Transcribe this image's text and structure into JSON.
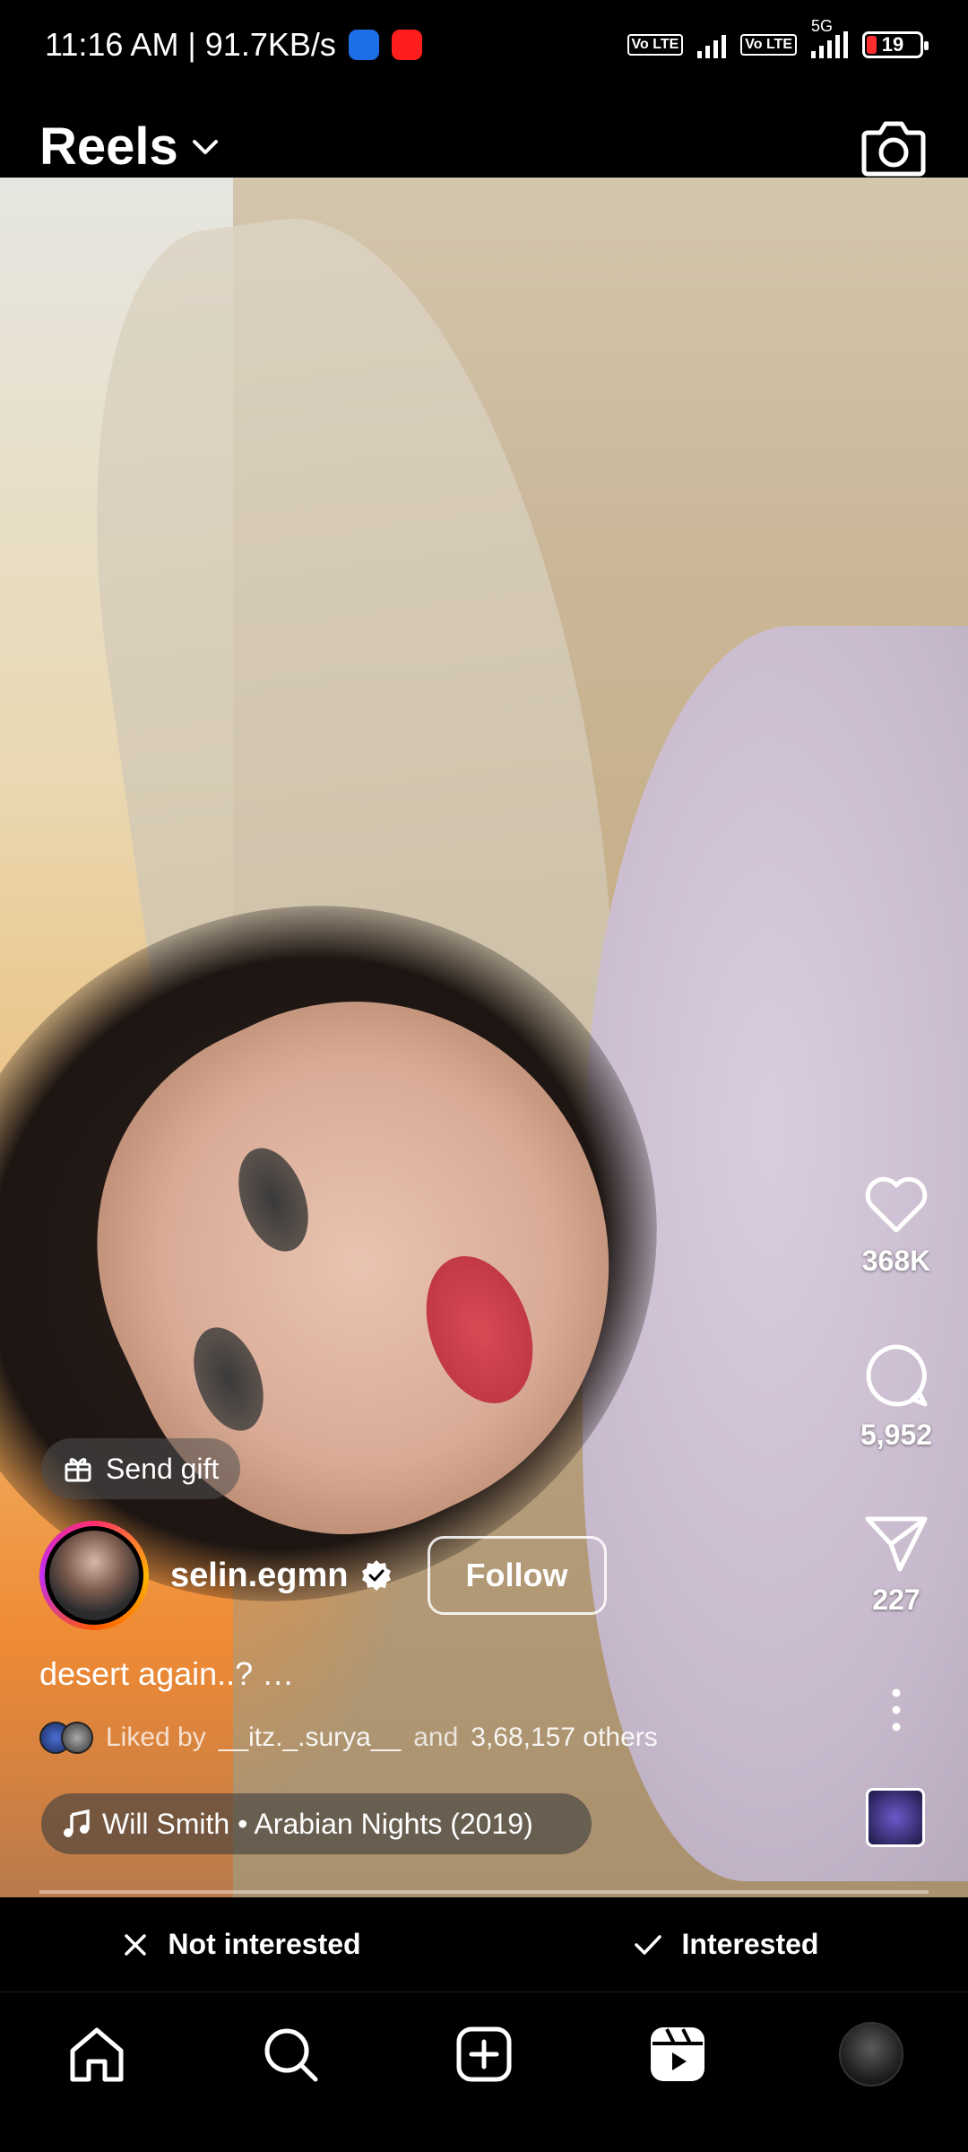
{
  "status_bar": {
    "time_speed": "11:16 AM | 91.7KB/s",
    "volte1": "Vo LTE",
    "volte2": "Vo LTE",
    "network": "5G",
    "battery": "19",
    "battery_level_percent": 19
  },
  "header": {
    "title": "Reels",
    "icons": [
      "chevron-down-icon",
      "camera-icon"
    ]
  },
  "actions": {
    "likes": "368K",
    "comments": "5,952",
    "shares": "227",
    "icons": [
      "heart-icon",
      "comment-icon",
      "send-icon",
      "more-icon"
    ]
  },
  "post": {
    "gift_label": "Send gift",
    "username": "selin.egmn",
    "follow_label": "Follow",
    "caption": "desert again..? …",
    "liked_prefix": "Liked by",
    "liked_user": "__itz._.surya__",
    "liked_and": "and",
    "liked_others": "3,68,157 others",
    "music": "Will Smith • Arabian Nights (2019)"
  },
  "interest": {
    "not_interested": "Not interested",
    "interested": "Interested"
  },
  "nav": {
    "items": [
      "home-icon",
      "search-icon",
      "create-icon",
      "reels-icon",
      "profile-avatar"
    ]
  },
  "colors": {
    "background": "#000000",
    "battery_low": "#ff2d2d",
    "avatar_ring": "#ff2d6e"
  }
}
